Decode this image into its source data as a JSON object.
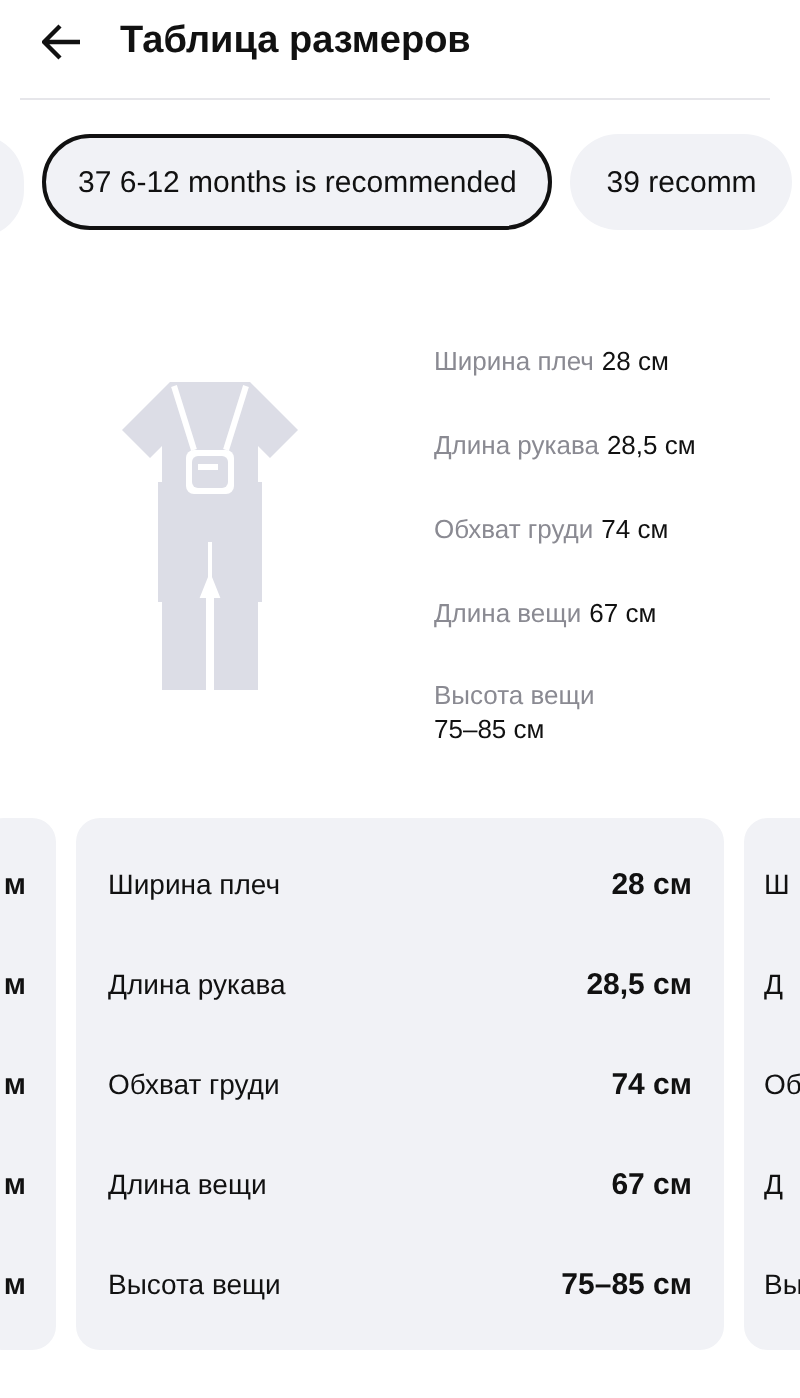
{
  "header": {
    "title": "Таблица размеров"
  },
  "sizes": [
    {
      "label": "37 6-12 months is recommended",
      "selected": true
    },
    {
      "label": "39 recomm",
      "selected": false
    }
  ],
  "summary": [
    {
      "label": "Ширина плеч",
      "value": "28 см"
    },
    {
      "label": "Длина рукава",
      "value": "28,5 см"
    },
    {
      "label": "Обхват груди",
      "value": "74 см"
    },
    {
      "label": "Длина вещи",
      "value": "67 см"
    },
    {
      "label": "Высота вещи",
      "value": "75–85 см",
      "wrap": true
    }
  ],
  "left_card": {
    "values": [
      "м",
      "м",
      "м",
      "м",
      "м"
    ]
  },
  "card": {
    "rows": [
      {
        "label": "Ширина плеч",
        "value": "28 см"
      },
      {
        "label": "Длина рукава",
        "value": "28,5 см"
      },
      {
        "label": "Обхват груди",
        "value": "74 см"
      },
      {
        "label": "Длина вещи",
        "value": "67 см"
      },
      {
        "label": "Высота вещи",
        "value": "75–85 см"
      }
    ]
  },
  "right_card": {
    "labels": [
      "Ш",
      "Д",
      "Об",
      "Д",
      "Вы"
    ]
  }
}
